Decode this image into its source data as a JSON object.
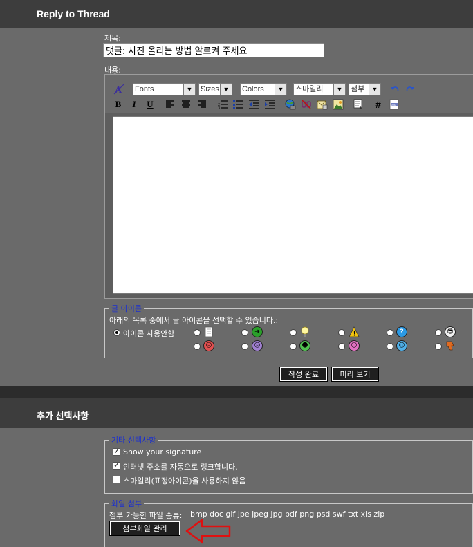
{
  "header": {
    "title": "Reply to Thread"
  },
  "form": {
    "subject_label": "제목:",
    "subject_value": "댓글: 사진 올리는 방법 알르켜 주세요",
    "content_label": "내용:"
  },
  "toolbar": {
    "fonts": "Fonts",
    "sizes": "Sizes",
    "colors": "Colors",
    "smilies": "스마일리",
    "attach": "첨부",
    "bold": "B",
    "italic": "I",
    "underline": "U",
    "hash": "#"
  },
  "post_icons": {
    "legend": "글 아이콘",
    "instruction": "아래의 목록 중에서 글 아이콘을 선택할 수 있습니다.:",
    "none_label": "아이콘 사용안함",
    "selected": "none"
  },
  "actions": {
    "submit": "작성 완료",
    "preview": "미리 보기"
  },
  "additional": {
    "title": "추가 선택사항",
    "misc": {
      "legend": "기타 선택사항",
      "options": [
        {
          "label": "Show your signature",
          "checked": true
        },
        {
          "label": "인터넷 주소를 자동으로 링크합니다.",
          "checked": true
        },
        {
          "label": "스마일리(표정아이콘)을 사용하지 않음",
          "checked": false
        }
      ]
    },
    "attachments": {
      "legend": "화일 첨부",
      "allowed_label": "첨부 가능한 파일 종류:",
      "allowed_types": "bmp doc gif jpe jpeg jpg pdf png psd swf txt xls zip",
      "manage_button": "첨부화일 관리"
    }
  },
  "colors": {
    "annotation_arrow": "#e01010",
    "legend_blue": "#1a2fd0"
  }
}
